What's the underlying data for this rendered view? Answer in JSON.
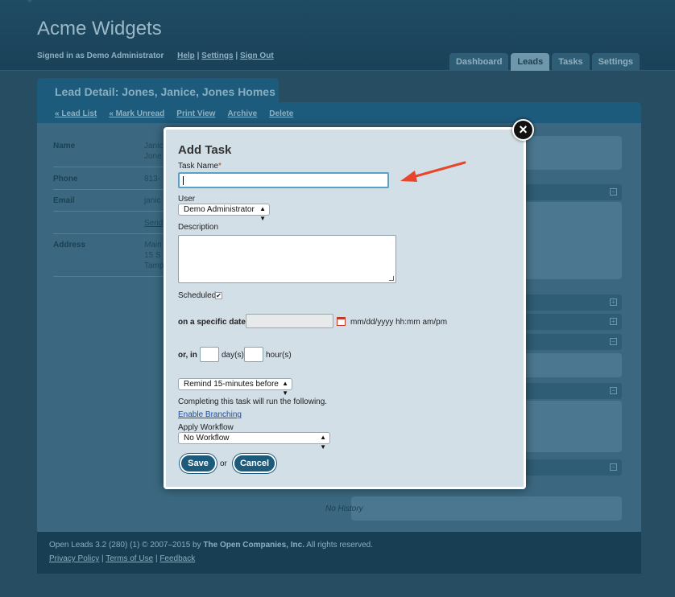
{
  "app": {
    "title": "Acme Widgets",
    "signed_in_text": "Signed in as Demo Administrator",
    "links": [
      "Help",
      "Settings",
      "Sign Out"
    ],
    "tabs": [
      {
        "label": "Dashboard",
        "active": false
      },
      {
        "label": "Leads",
        "active": true
      },
      {
        "label": "Tasks",
        "active": false
      },
      {
        "label": "Settings",
        "active": false
      }
    ]
  },
  "lead": {
    "title": "Lead Detail: Jones, Janice, Jones Homes",
    "nav": [
      "« Lead List",
      "« Mark Unread",
      "Print View",
      "Archive",
      "Delete"
    ],
    "fields": [
      {
        "label": "Name",
        "value": "Janic"
      },
      {
        "label": "Phone",
        "value": "813-"
      },
      {
        "label": "Email",
        "value": "janic"
      },
      {
        "label": "",
        "value": "Send"
      },
      {
        "label": "Address",
        "value": "Main"
      }
    ],
    "name_line2": "Jone",
    "address_line2": "15 S",
    "address_line3": "Tamp",
    "history_empty": "No History"
  },
  "modal": {
    "title": "Add Task",
    "task_name_label": "Task Name",
    "task_name_required": "*",
    "task_name_value": "",
    "user_label": "User",
    "user_value": "Demo Administrator",
    "description_label": "Description",
    "description_value": "",
    "scheduled_label": "Scheduled",
    "scheduled_checked": true,
    "specific_date_label": "on a specific date",
    "date_value": "",
    "date_format_hint": "mm/dd/yyyy hh:mm am/pm",
    "or_in_label": "or, in",
    "days_value": "",
    "days_label": "day(s)",
    "hours_value": "",
    "hours_label": "hour(s)",
    "remind_value": "Remind 15-minutes before",
    "completing_text": "Completing this task will run the following.",
    "enable_branching": "Enable Branching",
    "apply_workflow_label": "Apply Workflow",
    "workflow_value": "No Workflow",
    "save_label": "Save",
    "or_text": "or",
    "cancel_label": "Cancel",
    "close_glyph": "×"
  },
  "footer": {
    "copyright_prefix": "Open Leads 3.2 (280) (1) © 2007–2015 by ",
    "company": "The Open Companies, Inc.",
    "copyright_suffix": " All rights reserved.",
    "links": [
      "Privacy Policy",
      "Terms of Use",
      "Feedback"
    ]
  },
  "colors": {
    "header_bg": "#1f4b63",
    "accent": "#1d5b7d",
    "modal_bg": "#d3dfe6",
    "annotation_arrow": "#e8452c"
  }
}
